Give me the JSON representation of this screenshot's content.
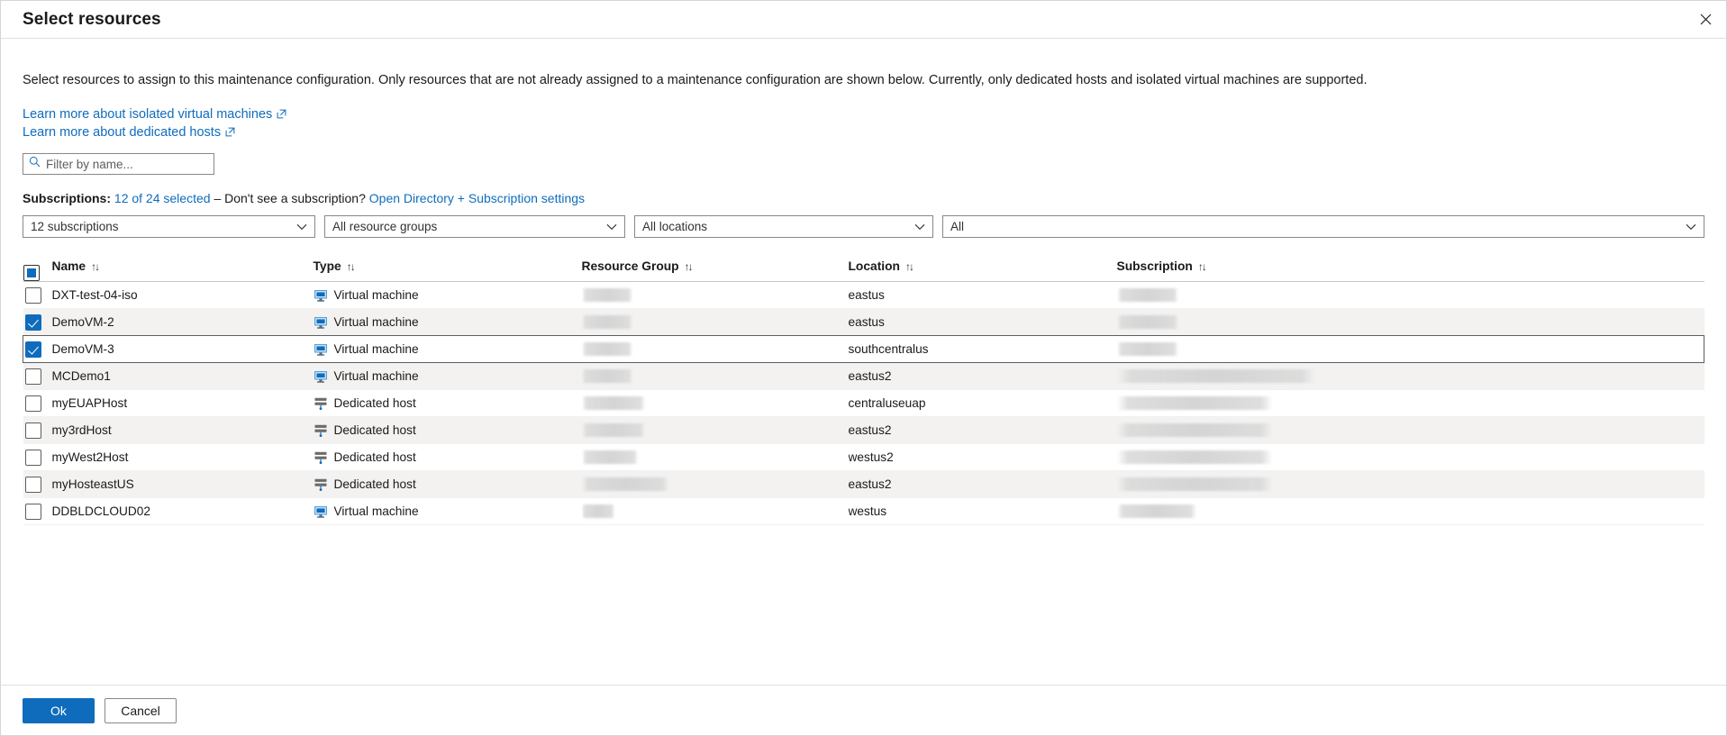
{
  "header": {
    "title": "Select resources",
    "close_icon": "close-icon"
  },
  "description": "Select resources to assign to this maintenance configuration. Only resources that are not already assigned to a maintenance configuration are shown below. Currently, only dedicated hosts and isolated virtual machines are supported.",
  "links": [
    {
      "label": "Learn more about isolated virtual machines",
      "icon": "external-link-icon"
    },
    {
      "label": "Learn more about dedicated hosts",
      "icon": "external-link-icon"
    }
  ],
  "filter": {
    "placeholder": "Filter by name...",
    "value": "",
    "icon": "search-icon"
  },
  "subscriptions_line": {
    "label": "Subscriptions:",
    "selected_link": "12 of 24 selected",
    "separator": "– Don't see a subscription?",
    "settings_link": "Open Directory + Subscription settings"
  },
  "dropdowns": [
    {
      "name": "subscription-filter",
      "value": "12 subscriptions"
    },
    {
      "name": "resource-group-filter",
      "value": "All resource groups"
    },
    {
      "name": "location-filter",
      "value": "All locations"
    },
    {
      "name": "type-filter",
      "value": "All"
    }
  ],
  "table": {
    "columns": [
      {
        "key": "name",
        "label": "Name",
        "sort": "↑↓"
      },
      {
        "key": "type",
        "label": "Type",
        "sort": "↑↓"
      },
      {
        "key": "resource_group",
        "label": "Resource Group",
        "sort": "↑↓"
      },
      {
        "key": "location",
        "label": "Location",
        "sort": "↑↓"
      },
      {
        "key": "subscription",
        "label": "Subscription",
        "sort": "↑↓"
      }
    ],
    "select_all_state": "indeterminate",
    "rows": [
      {
        "name": "DXT-test-04-iso",
        "type": "Virtual machine",
        "type_icon": "virtual-machine-icon",
        "location": "eastus",
        "selected": false,
        "focused": false,
        "rg_redacted_width": 56,
        "sub_redacted_width": 68
      },
      {
        "name": "DemoVM-2",
        "type": "Virtual machine",
        "type_icon": "virtual-machine-icon",
        "location": "eastus",
        "selected": true,
        "focused": false,
        "rg_redacted_width": 56,
        "sub_redacted_width": 68
      },
      {
        "name": "DemoVM-3",
        "type": "Virtual machine",
        "type_icon": "virtual-machine-icon",
        "location": "southcentralus",
        "selected": true,
        "focused": true,
        "rg_redacted_width": 56,
        "sub_redacted_width": 68
      },
      {
        "name": "MCDemo1",
        "type": "Virtual machine",
        "type_icon": "virtual-machine-icon",
        "location": "eastus2",
        "selected": false,
        "focused": false,
        "rg_redacted_width": 56,
        "sub_redacted_width": 220
      },
      {
        "name": "myEUAPHost",
        "type": "Dedicated host",
        "type_icon": "dedicated-host-icon",
        "location": "centraluseuap",
        "selected": false,
        "focused": false,
        "rg_redacted_width": 70,
        "sub_redacted_width": 172
      },
      {
        "name": "my3rdHost",
        "type": "Dedicated host",
        "type_icon": "dedicated-host-icon",
        "location": "eastus2",
        "selected": false,
        "focused": false,
        "rg_redacted_width": 70,
        "sub_redacted_width": 172
      },
      {
        "name": "myWest2Host",
        "type": "Dedicated host",
        "type_icon": "dedicated-host-icon",
        "location": "westus2",
        "selected": false,
        "focused": false,
        "rg_redacted_width": 62,
        "sub_redacted_width": 172
      },
      {
        "name": "myHosteastUS",
        "type": "Dedicated host",
        "type_icon": "dedicated-host-icon",
        "location": "eastus2",
        "selected": false,
        "focused": false,
        "rg_redacted_width": 96,
        "sub_redacted_width": 172
      },
      {
        "name": "DDBLDCLOUD02",
        "type": "Virtual machine",
        "type_icon": "virtual-machine-icon",
        "location": "westus",
        "selected": false,
        "focused": false,
        "rg_redacted_width": 36,
        "sub_redacted_width": 88
      }
    ]
  },
  "footer": {
    "ok_label": "Ok",
    "cancel_label": "Cancel"
  },
  "colors": {
    "accent": "#0f6cbd",
    "link": "#0f6cbd",
    "alt_row": "#f3f2f1",
    "border": "#c8c6c4"
  }
}
